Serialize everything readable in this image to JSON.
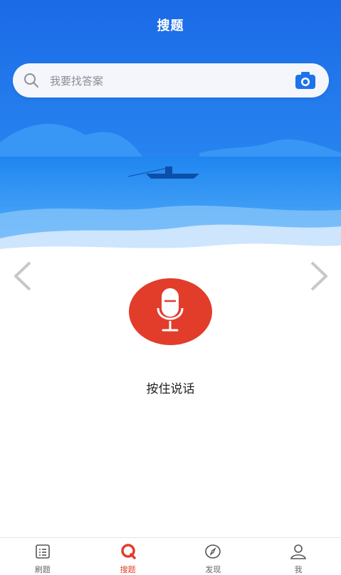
{
  "header": {
    "title": "搜题"
  },
  "search": {
    "placeholder": "我要找答案"
  },
  "voice": {
    "hint": "按住说话"
  },
  "colors": {
    "accent": "#e23d2a",
    "sky": "#1d73ea"
  },
  "nav": [
    {
      "label": "刷题",
      "icon": "list-icon",
      "active": false
    },
    {
      "label": "搜题",
      "icon": "search-tab-icon",
      "active": true
    },
    {
      "label": "发现",
      "icon": "compass-icon",
      "active": false
    },
    {
      "label": "我",
      "icon": "user-icon",
      "active": false
    }
  ]
}
